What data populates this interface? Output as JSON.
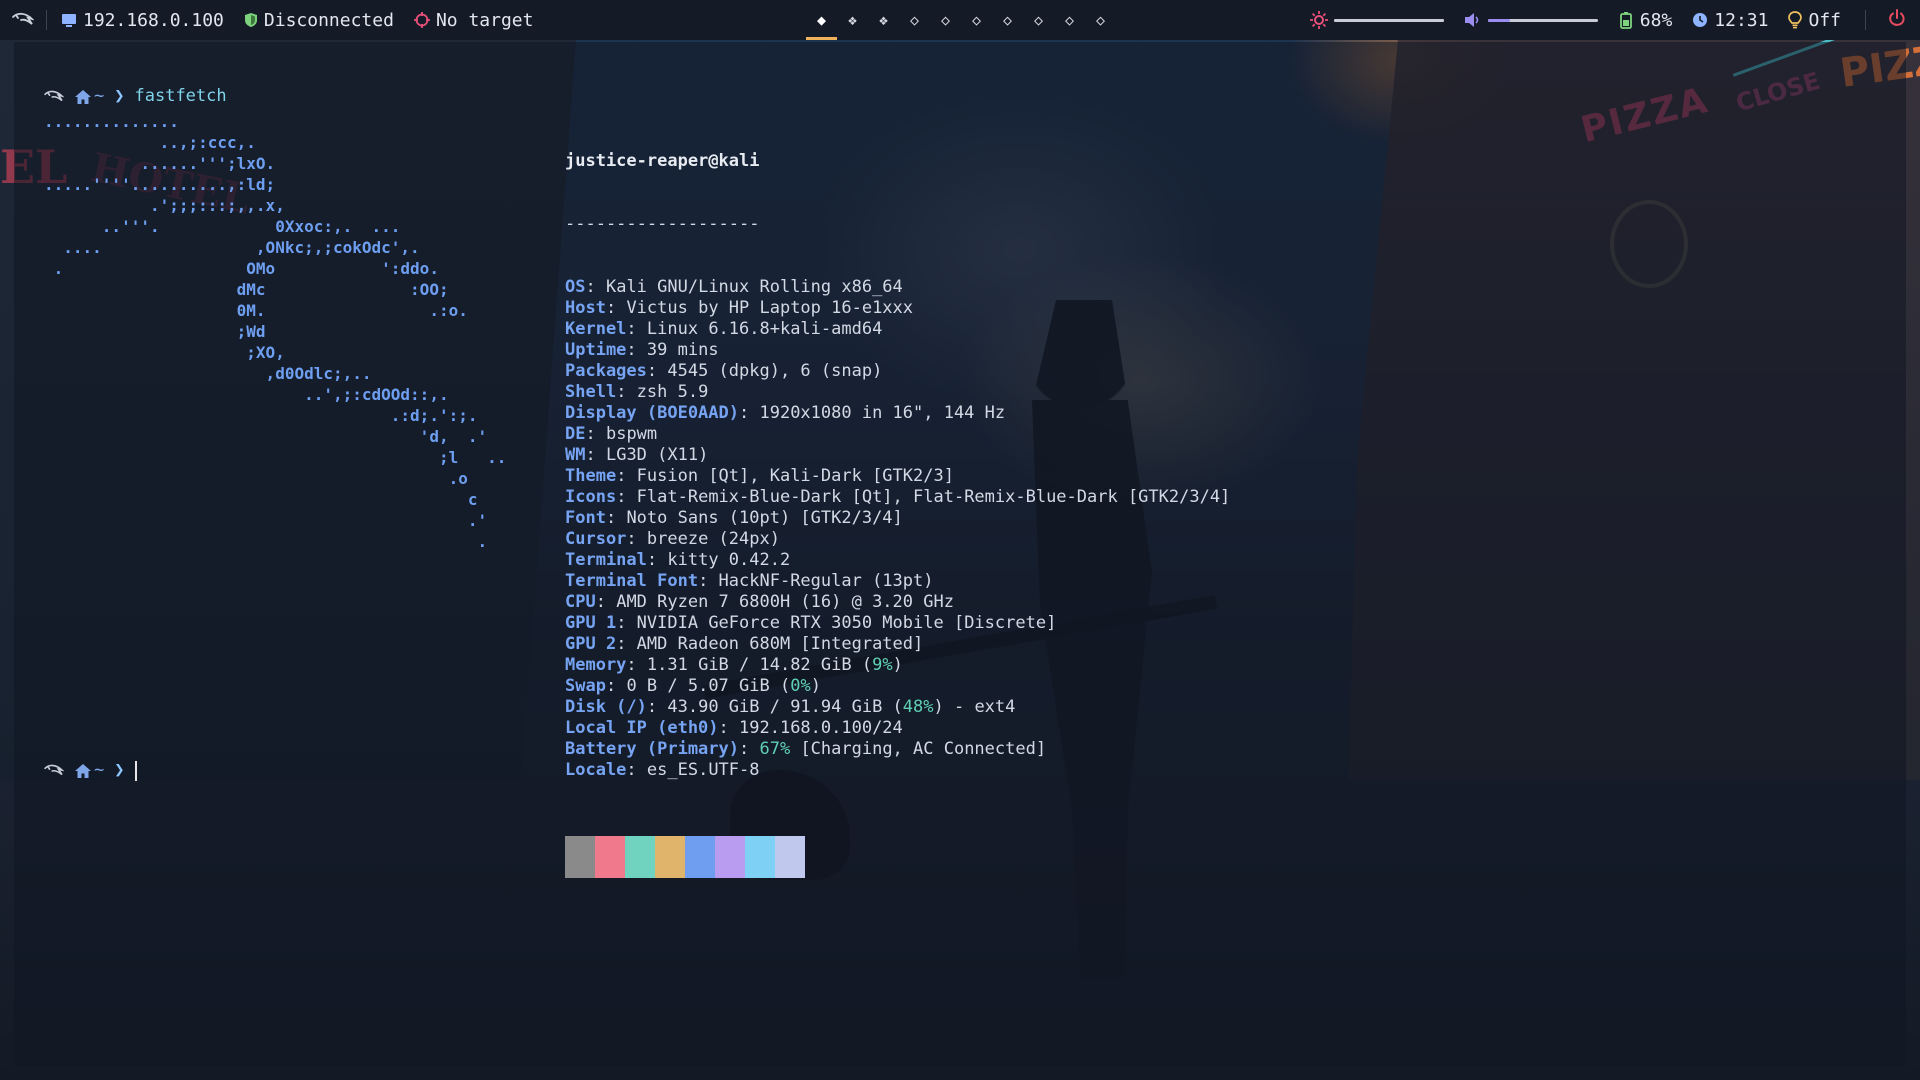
{
  "topbar": {
    "ip": "192.168.0.100",
    "vpn_status": "Disconnected",
    "target": "No target",
    "workspaces": [
      {
        "glyph": "◆",
        "active": true
      },
      {
        "glyph": "❖",
        "active": false
      },
      {
        "glyph": "❖",
        "active": false
      },
      {
        "glyph": "◇",
        "active": false
      },
      {
        "glyph": "◇",
        "active": false
      },
      {
        "glyph": "◇",
        "active": false
      },
      {
        "glyph": "◇",
        "active": false
      },
      {
        "glyph": "◇",
        "active": false
      },
      {
        "glyph": "◇",
        "active": false
      },
      {
        "glyph": "◇",
        "active": false
      }
    ],
    "brightness_level": 1.0,
    "volume_level": 0.2,
    "battery": "68%",
    "time": "12:31",
    "light": "Off",
    "colors": {
      "brightness": "#e8507a",
      "volume": "#9b8cf0",
      "battery": "#7dd37d",
      "clock": "#8fb4ff",
      "bulb": "#f0c060",
      "power": "#e84c5e",
      "accent": "#f0b35c"
    }
  },
  "terminal": {
    "command": "fastfetch",
    "ascii_logo": [
      "..............",
      "            ..,;:ccc,.",
      "          ......''';lxO.",
      ".....''''..........,:ld;",
      "           .';;;:::;,,.x,",
      "      ..'''.            0Xxoc:,.  ...",
      "  ....                ,ONkc;,;cokOdc',.",
      " .                   OMo           ':ddo.",
      "                    dMc               :OO;",
      "                    0M.                 .:o.",
      "                    ;Wd",
      "                     ;XO,",
      "                       ,d0Odlc;,..",
      "                           ..',;:cdOOd::,.",
      "                                    .:d;.':;.",
      "                                       'd,  .'",
      "                                         ;l   ..",
      "                                          .o",
      "                                            c",
      "                                            .'",
      "                                             ."
    ],
    "user_host": "justice-reaper@kali",
    "separator": "-------------------",
    "info": [
      {
        "key": "OS",
        "value": "Kali GNU/Linux Rolling x86_64"
      },
      {
        "key": "Host",
        "value": "Victus by HP Laptop 16-e1xxx"
      },
      {
        "key": "Kernel",
        "value": "Linux 6.16.8+kali-amd64"
      },
      {
        "key": "Uptime",
        "value": "39 mins"
      },
      {
        "key": "Packages",
        "value": "4545 (dpkg), 6 (snap)"
      },
      {
        "key": "Shell",
        "value": "zsh 5.9"
      },
      {
        "key": "Display (BOE0AAD)",
        "value": "1920x1080 in 16\", 144 Hz"
      },
      {
        "key": "DE",
        "value": "bspwm"
      },
      {
        "key": "WM",
        "value": "LG3D (X11)"
      },
      {
        "key": "Theme",
        "value": "Fusion [Qt], Kali-Dark [GTK2/3]"
      },
      {
        "key": "Icons",
        "value": "Flat-Remix-Blue-Dark [Qt], Flat-Remix-Blue-Dark [GTK2/3/4]"
      },
      {
        "key": "Font",
        "value": "Noto Sans (10pt) [GTK2/3/4]"
      },
      {
        "key": "Cursor",
        "value": "breeze (24px)"
      },
      {
        "key": "Terminal",
        "value": "kitty 0.42.2"
      },
      {
        "key": "Terminal Font",
        "value": "HackNF-Regular (13pt)"
      },
      {
        "key": "CPU",
        "value": "AMD Ryzen 7 6800H (16) @ 3.20 GHz"
      },
      {
        "key": "GPU 1",
        "value": "NVIDIA GeForce RTX 3050 Mobile [Discrete]"
      },
      {
        "key": "GPU 2",
        "value": "AMD Radeon 680M [Integrated]"
      },
      {
        "key": "Memory",
        "value": "1.31 GiB / 14.82 GiB (",
        "pct": "9%",
        "after": ")"
      },
      {
        "key": "Swap",
        "value": "0 B / 5.07 GiB (",
        "pct": "0%",
        "after": ")"
      },
      {
        "key": "Disk (/)",
        "value": "43.90 GiB / 91.94 GiB (",
        "pct": "48%",
        "after": ") - ext4"
      },
      {
        "key": "Local IP (eth0)",
        "value": "192.168.0.100/24"
      },
      {
        "key": "Battery (Primary)",
        "value": "",
        "pct": "67%",
        "after": " [Charging, AC Connected]"
      },
      {
        "key": "Locale",
        "value": "es_ES.UTF-8"
      }
    ],
    "palette": [
      "#8a8a8a",
      "#f07a8c",
      "#6fd3c0",
      "#e0b46a",
      "#6f9ef0",
      "#b99cf0",
      "#7fd0f5",
      "#c0c8ee"
    ]
  }
}
